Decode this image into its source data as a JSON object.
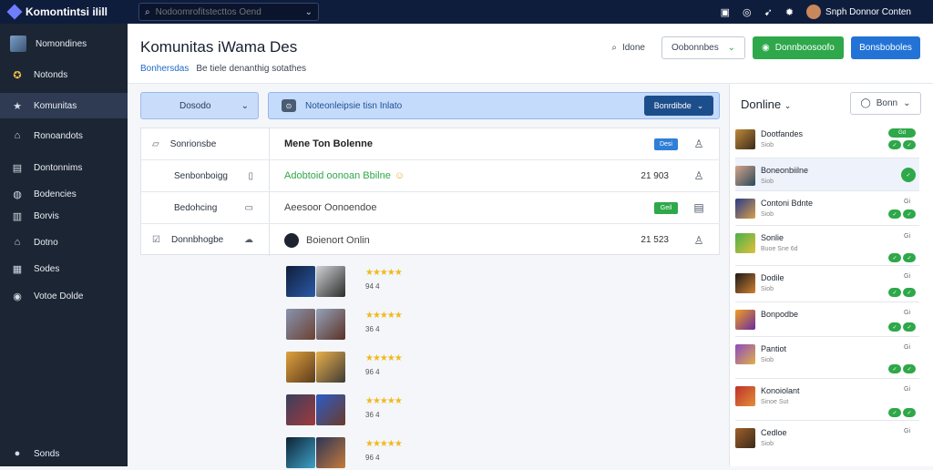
{
  "topbar": {
    "brand": "Komontintsi iIill",
    "search_placeholder": "Nodoomrofitstecttos Oend",
    "user_name": "Snph Donnor Conten",
    "icons": [
      "window-icon",
      "help-icon",
      "bolt-icon",
      "settings-icon"
    ]
  },
  "sidebar": {
    "items": [
      {
        "label": "Nomondines",
        "icon": "thumbnail"
      },
      {
        "label": "Notonds",
        "icon": "badge-icon"
      },
      {
        "label": "Komunitas",
        "icon": "star-icon",
        "active": true
      },
      {
        "label": "Ronoandots",
        "icon": "home-icon"
      },
      {
        "label": "Dontonnims",
        "icon": "grid-icon"
      },
      {
        "label": "Bodencies",
        "icon": "globe-icon"
      },
      {
        "label": "Borvis",
        "icon": "book-icon"
      },
      {
        "label": "Dotno",
        "icon": "house-icon"
      },
      {
        "label": "Sodes",
        "icon": "table-icon"
      },
      {
        "label": "Votoe Dolde",
        "icon": "record-icon"
      },
      {
        "label": "Sonds",
        "icon": "user-icon"
      }
    ]
  },
  "header": {
    "title": "Komunitas iWama Des",
    "breadcrumb_1": "Bonhersdas",
    "breadcrumb_2": "Be tiele denanthig sotathes",
    "search_label": "Idone",
    "dropdown_label": "Oobonnbes",
    "green_button": "Donnboosoofo",
    "blue_button": "Bonsboboles"
  },
  "filter": {
    "dropdown": "Dosodo"
  },
  "banner": {
    "text": "Noteonleipsie tisn Inlato",
    "button": "Bonrdibde"
  },
  "table": {
    "left_rows": [
      {
        "label": "Sonrionsbe"
      },
      {
        "label": "Senbonboigg"
      },
      {
        "label": "Bedohcing"
      },
      {
        "label": "Donnbhogbe"
      }
    ],
    "main_rows": [
      {
        "text": "Mene Ton Bolenne",
        "tag": "Desi"
      },
      {
        "text": "Adobtoid oonoan Bbilne",
        "number": "21 903"
      },
      {
        "text": "Aeesoor Oonoendoe",
        "tag": "Geil"
      },
      {
        "text": "Boienort Onlin",
        "number": "21 523"
      }
    ]
  },
  "games": [
    {
      "rating": "★★★★★",
      "label": "94 4"
    },
    {
      "rating": "★★★★★",
      "label": "36 4"
    },
    {
      "rating": "★★★★★",
      "label": "96 4"
    },
    {
      "rating": "★★★★★",
      "label": "36 4"
    },
    {
      "rating": "★★★★★",
      "label": "96 4"
    }
  ],
  "right_panel": {
    "title": "Donline",
    "button": "Bonn",
    "people": [
      {
        "name": "Dootfandes",
        "sub": "Siob",
        "tag": "Gd"
      },
      {
        "name": "Boneonbiilne",
        "sub": "Siob",
        "tag": ""
      },
      {
        "name": "Contoni Bdnte",
        "sub": "Siob",
        "tag": "Gi"
      },
      {
        "name": "Sonlie",
        "sub": "Buoe Sne 6d",
        "tag": "Gi"
      },
      {
        "name": "Dodile",
        "sub": "Siob",
        "tag": "Gi"
      },
      {
        "name": "Bonpodbe",
        "sub": "",
        "tag": "Gi"
      },
      {
        "name": "Pantiot",
        "sub": "Siob",
        "tag": "Gi"
      },
      {
        "name": "Konoiolant",
        "sub": "Sinoe Sut",
        "tag": "Gi"
      },
      {
        "name": "Cedloe",
        "sub": "Siob",
        "tag": "Gi"
      }
    ]
  }
}
